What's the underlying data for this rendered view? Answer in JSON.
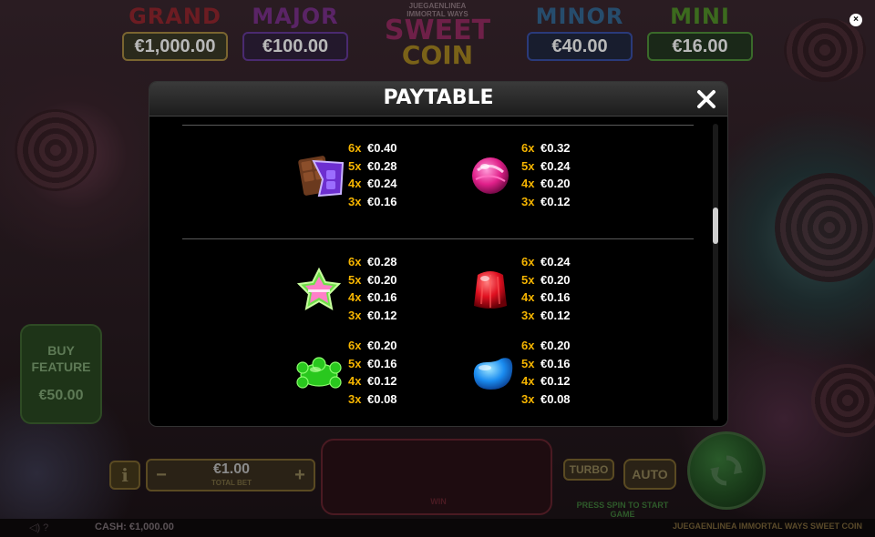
{
  "jackpots": [
    {
      "name": "GRAND",
      "amount": "€1,000.00"
    },
    {
      "name": "MAJOR",
      "amount": "€100.00"
    },
    {
      "name": "MINOR",
      "amount": "€40.00"
    },
    {
      "name": "MINI",
      "amount": "€16.00"
    }
  ],
  "logo": {
    "line1": "JUEGAENLINEA",
    "line2": "IMMORTAL WAYS",
    "line3": "SWEET",
    "line4": "COIN"
  },
  "close_glyph": "×",
  "buy_feature": {
    "label_line1": "BUY",
    "label_line2": "FEATURE",
    "price": "€50.00"
  },
  "controls": {
    "info_glyph": "i",
    "bet_minus": "−",
    "bet_plus": "+",
    "bet_value": "€1.00",
    "bet_label": "TOTAL BET",
    "win_label": "WIN",
    "turbo_label": "TURBO",
    "auto_label": "AUTO",
    "press_spin": "PRESS SPIN TO START GAME"
  },
  "status_bar": {
    "icons": "◁)  ?",
    "cash": "CASH:  €1,000.00",
    "game_name": "JUEGAENLINEA IMMORTAL WAYS SWEET COIN"
  },
  "paytable": {
    "title": "PAYTABLE",
    "entries": [
      {
        "symbol": "chocolate-bar",
        "pays": [
          {
            "count": "6x",
            "amount": "€0.40"
          },
          {
            "count": "5x",
            "amount": "€0.28"
          },
          {
            "count": "4x",
            "amount": "€0.24"
          },
          {
            "count": "3x",
            "amount": "€0.16"
          }
        ]
      },
      {
        "symbol": "pink-lollipop",
        "pays": [
          {
            "count": "6x",
            "amount": "€0.32"
          },
          {
            "count": "5x",
            "amount": "€0.24"
          },
          {
            "count": "4x",
            "amount": "€0.20"
          },
          {
            "count": "3x",
            "amount": "€0.12"
          }
        ]
      },
      {
        "symbol": "star-candy",
        "pays": [
          {
            "count": "6x",
            "amount": "€0.28"
          },
          {
            "count": "5x",
            "amount": "€0.20"
          },
          {
            "count": "4x",
            "amount": "€0.16"
          },
          {
            "count": "3x",
            "amount": "€0.12"
          }
        ]
      },
      {
        "symbol": "red-jelly",
        "pays": [
          {
            "count": "6x",
            "amount": "€0.24"
          },
          {
            "count": "5x",
            "amount": "€0.20"
          },
          {
            "count": "4x",
            "amount": "€0.16"
          },
          {
            "count": "3x",
            "amount": "€0.12"
          }
        ]
      },
      {
        "symbol": "green-gummy-bear",
        "pays": [
          {
            "count": "6x",
            "amount": "€0.20"
          },
          {
            "count": "5x",
            "amount": "€0.16"
          },
          {
            "count": "4x",
            "amount": "€0.12"
          },
          {
            "count": "3x",
            "amount": "€0.08"
          }
        ]
      },
      {
        "symbol": "blue-jelly-bean",
        "pays": [
          {
            "count": "6x",
            "amount": "€0.20"
          },
          {
            "count": "5x",
            "amount": "€0.16"
          },
          {
            "count": "4x",
            "amount": "€0.12"
          },
          {
            "count": "3x",
            "amount": "€0.08"
          }
        ]
      }
    ]
  },
  "colors": {
    "count_accent": "#f5b400",
    "modal_bg": "#000000",
    "header_bg": "#2a2a2a"
  }
}
